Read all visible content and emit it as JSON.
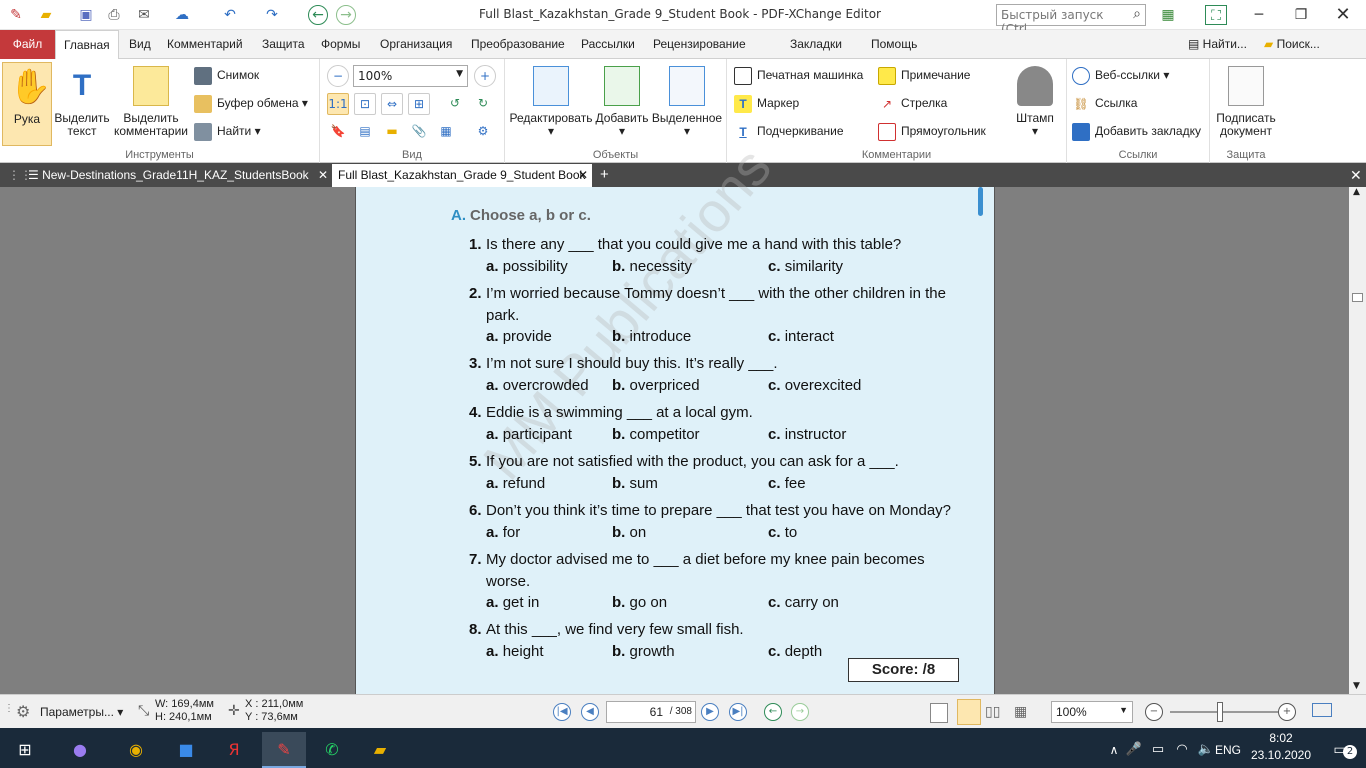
{
  "window": {
    "title": "Full Blast_Kazakhstan_Grade 9_Student Book - PDF-XChange Editor",
    "quick_launch_placeholder": "Быстрый запуск (Ctrl..."
  },
  "ribbon_tabs": [
    "Файл",
    "Главная",
    "Вид",
    "Комментарий",
    "Защита",
    "Формы",
    "Организация",
    "Преобразование",
    "Рассылки",
    "Рецензирование",
    "Закладки",
    "Помощь"
  ],
  "ribbon_right": {
    "find": "Найти...",
    "search": "Поиск..."
  },
  "groups": {
    "tools": {
      "label": "Инструменты",
      "hand": "Рука",
      "select_text": "Выделить текст",
      "select_comments": "Выделить комментарии",
      "snapshot": "Снимок",
      "clipboard": "Буфер обмена",
      "find": "Найти"
    },
    "view": {
      "label": "Вид",
      "zoom": "100%"
    },
    "objects": {
      "label": "Объекты",
      "edit": "Редактировать",
      "add": "Добавить",
      "selected": "Выделенное"
    },
    "comments": {
      "label": "Комментарии",
      "typewriter": "Печатная машинка",
      "note": "Примечание",
      "marker": "Маркер",
      "arrow": "Стрелка",
      "underline": "Подчеркивание",
      "rectangle": "Прямоугольник",
      "stamp": "Штамп"
    },
    "links": {
      "label": "Ссылки",
      "web_links": "Веб-ссылки",
      "link": "Ссылка",
      "add_bookmark": "Добавить закладку"
    },
    "protect": {
      "label": "Защита",
      "sign": "Подписать документ"
    }
  },
  "doc_tabs": [
    "New-Destinations_Grade11H_KAZ_StudentsBook",
    "Full Blast_Kazakhstan_Grade 9_Student Book"
  ],
  "page": {
    "heading_letter": "A.",
    "heading": "Choose a, b or c.",
    "questions": [
      {
        "n": "1.",
        "text": "Is there any ___ that you could give me a hand with this table?",
        "text2": "",
        "a": "possibility",
        "b": "necessity",
        "c": "similarity"
      },
      {
        "n": "2.",
        "text": "I’m worried because Tommy doesn’t ___ with the other children in the",
        "text2": "park.",
        "a": "provide",
        "b": "introduce",
        "c": "interact"
      },
      {
        "n": "3.",
        "text": "I’m not sure I should buy this. It’s really ___.",
        "text2": "",
        "a": "overcrowded",
        "b": "overpriced",
        "c": "overexcited"
      },
      {
        "n": "4.",
        "text": "Eddie is a swimming ___ at a local gym.",
        "text2": "",
        "a": "participant",
        "b": "competitor",
        "c": "instructor"
      },
      {
        "n": "5.",
        "text": "If you are not satisfied with the product, you can ask for a ___.",
        "text2": "",
        "a": "refund",
        "b": "sum",
        "c": "fee"
      },
      {
        "n": "6.",
        "text": "Don’t you think it’s time to prepare ___ that test you have on Monday?",
        "text2": "",
        "a": "for",
        "b": "on",
        "c": "to"
      },
      {
        "n": "7.",
        "text": "My doctor advised me to ___ a diet before my knee pain becomes",
        "text2": "worse.",
        "a": "get in",
        "b": "go on",
        "c": "carry on"
      },
      {
        "n": "8.",
        "text": "At this ___, we find very few small fish.",
        "text2": "",
        "a": "height",
        "b": "growth",
        "c": "depth"
      }
    ],
    "option_letters": {
      "a": "a.",
      "b": "b.",
      "c": "c."
    },
    "score": "Score:   /8",
    "watermark": "MM Publications"
  },
  "status": {
    "settings": "Параметры...",
    "width": "W: 169,4мм",
    "height": "H: 240,1мм",
    "x": "X : 211,0мм",
    "y": "Y :   73,6мм",
    "page_current": "61",
    "page_total": "/ 308",
    "zoom": "100%"
  },
  "taskbar": {
    "lang": "ENG",
    "time": "8:02",
    "date": "23.10.2020",
    "notifications": "2"
  }
}
